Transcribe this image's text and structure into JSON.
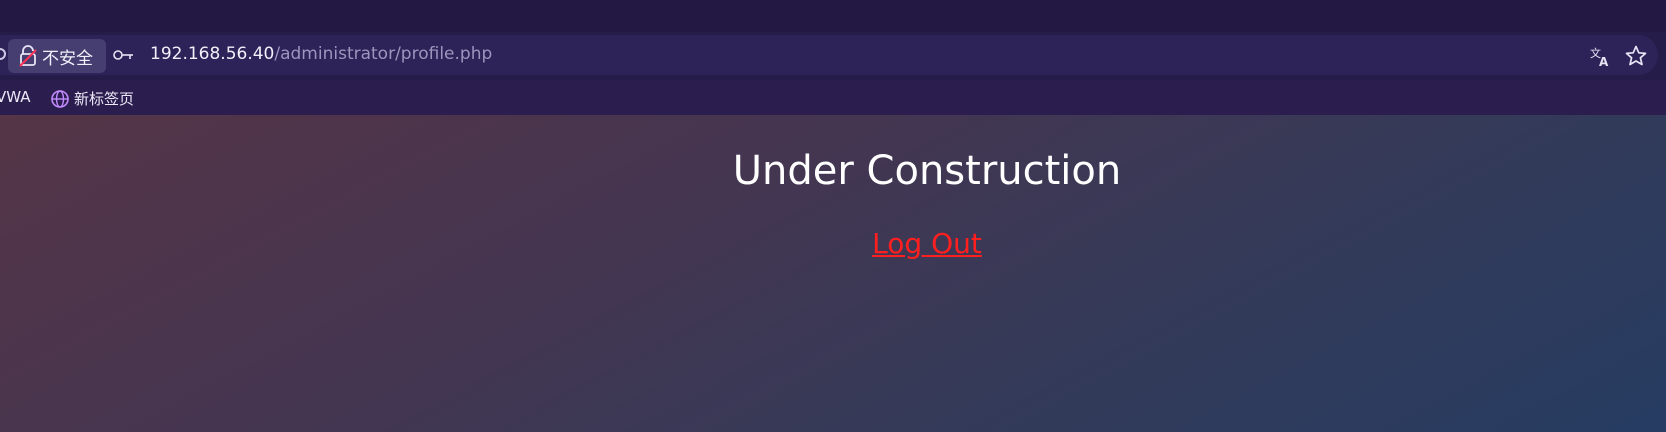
{
  "browser": {
    "security_label": "不安全",
    "url_host": "192.168.56.40",
    "url_path": "/administrator/profile.php",
    "icons": [
      "lock-icon",
      "key-icon",
      "translate-icon",
      "star-icon",
      "globe-icon"
    ]
  },
  "bookmarks": [
    {
      "label": "VWA"
    },
    {
      "label": "新标签页",
      "icon": "globe-icon"
    }
  ],
  "page": {
    "heading": "Under Construction",
    "logout_label": "Log Out",
    "colors": {
      "link": "#ff1f1f",
      "heading": "#ffffff"
    }
  }
}
